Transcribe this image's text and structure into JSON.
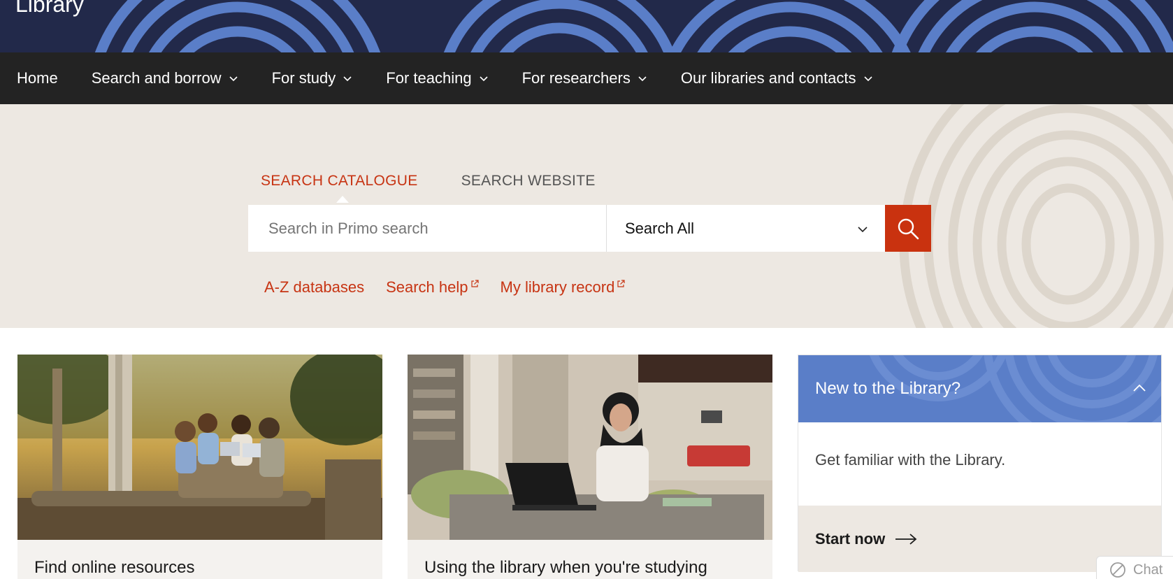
{
  "header": {
    "site_title": "Library"
  },
  "nav": {
    "items": [
      {
        "label": "Home",
        "has_dropdown": false
      },
      {
        "label": "Search and borrow",
        "has_dropdown": true
      },
      {
        "label": "For study",
        "has_dropdown": true
      },
      {
        "label": "For teaching",
        "has_dropdown": true
      },
      {
        "label": "For researchers",
        "has_dropdown": true
      },
      {
        "label": "Our libraries and contacts",
        "has_dropdown": true
      }
    ]
  },
  "search": {
    "tabs": [
      {
        "label": "SEARCH CATALOGUE",
        "active": true
      },
      {
        "label": "SEARCH WEBSITE",
        "active": false
      }
    ],
    "placeholder": "Search in Primo search",
    "scope_selected": "Search All",
    "submit_icon": "search-icon",
    "quick_links": [
      {
        "label": "A-Z databases",
        "external": false
      },
      {
        "label": "Search help",
        "external": true
      },
      {
        "label": "My library record",
        "external": true
      }
    ]
  },
  "cards": [
    {
      "title": "Find online resources"
    },
    {
      "title": "Using the library when you're studying"
    }
  ],
  "new_panel": {
    "title": "New to the Library?",
    "body": "Get familiar with the Library.",
    "cta": "Start now"
  },
  "chat": {
    "label": "Chat"
  },
  "colors": {
    "accent_red": "#c9320f",
    "nav_bg": "#232323",
    "banner_dark": "#22294a",
    "banner_blue": "#5a7ec8",
    "hero_bg": "#ede8e2"
  }
}
